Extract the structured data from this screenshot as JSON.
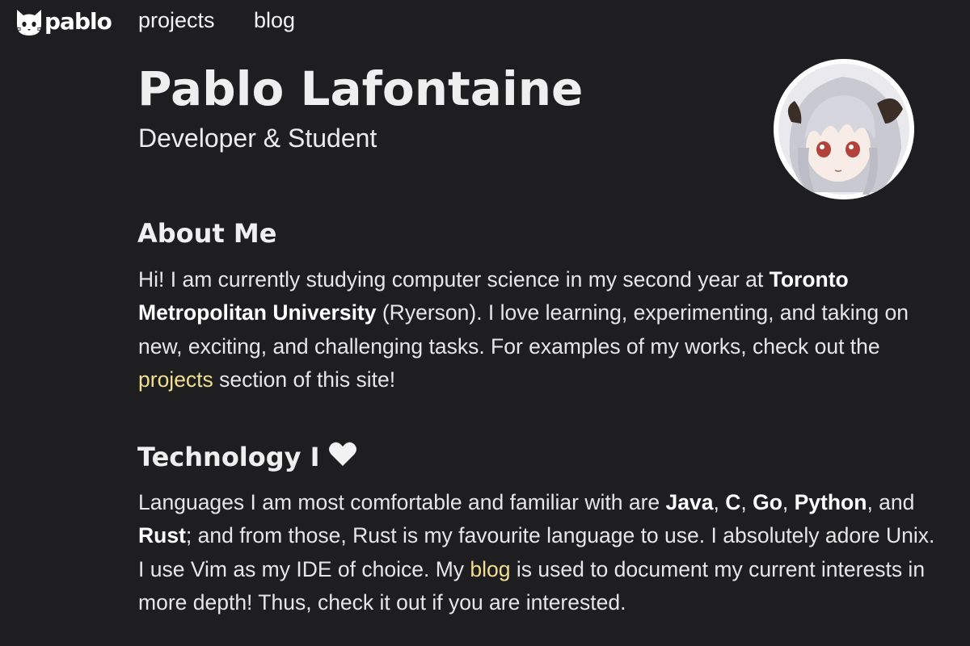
{
  "nav": {
    "logo_text": "pablo",
    "links": [
      "projects",
      "blog"
    ]
  },
  "header": {
    "name": "Pablo Lafontaine",
    "tagline": "Developer & Student"
  },
  "about": {
    "title": "About Me",
    "p1": "Hi! I am currently studying computer science in my second year at ",
    "university": "Toronto Metropolitan University",
    "p2": " (Ryerson). I love learning, experimenting, and taking on new, exciting, and challenging tasks. For examples of my works, check out the ",
    "projects_link": "projects",
    "p3": " section of this site!"
  },
  "tech": {
    "title": "Technology I",
    "heart_icon": "heart-icon",
    "p1": "Languages I am most comfortable and familiar with are ",
    "java": "Java",
    "sep1": ", ",
    "c": "C",
    "sep2": ", ",
    "go": "Go",
    "sep3": ", ",
    "python": "Python",
    "sep4": ", and ",
    "rust": "Rust",
    "p2": "; and from those, Rust is my favourite language to use. I absolutely adore Unix. I use Vim as my IDE of choice. My ",
    "blog_link": "blog",
    "p3": " is used to document my current interests in more depth! Thus, check it out if you are interested."
  },
  "colors": {
    "background": "#1e1e20",
    "text": "#ececec",
    "link": "#f2df8e"
  }
}
